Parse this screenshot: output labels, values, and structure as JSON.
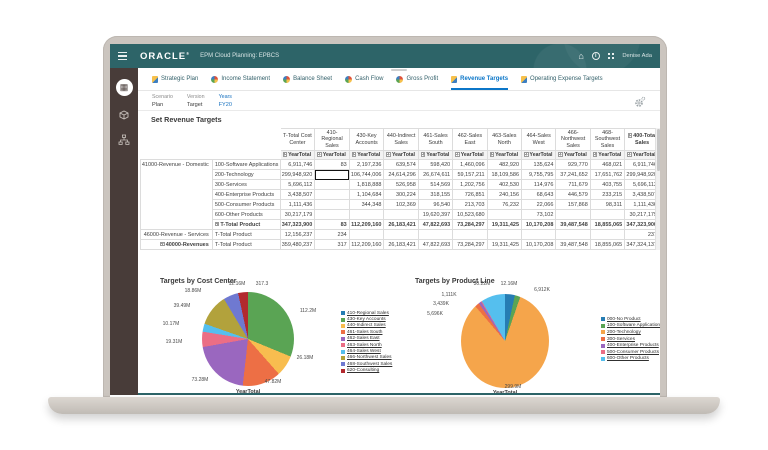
{
  "window": {
    "brand": "ORACLE",
    "brand_mark": "®",
    "app_title": "EPM Cloud Planning: EPBCS",
    "user": "Denise Ada",
    "header_icons": [
      "hamburger-icon",
      "home-icon",
      "info-icon",
      "apps-grid-icon"
    ]
  },
  "sidebar": {
    "icons": [
      "forms-grid-icon",
      "cube-icon",
      "org-chart-icon"
    ]
  },
  "tabs": [
    {
      "label": "Strategic Plan",
      "icon": "form",
      "active": false
    },
    {
      "label": "Income Statement",
      "icon": "chart",
      "active": false
    },
    {
      "label": "Balance Sheet",
      "icon": "chart",
      "active": false
    },
    {
      "label": "Cash Flow",
      "icon": "chart",
      "active": false
    },
    {
      "label": "Gross Profit",
      "icon": "chart",
      "active": false
    },
    {
      "label": "Revenue Targets",
      "icon": "form",
      "active": true
    },
    {
      "label": "Operating Expense Targets",
      "icon": "form",
      "active": false
    }
  ],
  "pov": {
    "items": [
      {
        "dim": "Scenario",
        "member": "Plan",
        "link": false
      },
      {
        "dim": "Version",
        "member": "Target",
        "link": false
      },
      {
        "dim": "Years",
        "member": "FY20",
        "link": true
      }
    ]
  },
  "page_title": "Set Revenue Targets",
  "grid": {
    "columns": [
      "T-Total Cost Center",
      "410-Regional Sales",
      "430-Key Accounts",
      "440-Indirect Sales",
      "461-Sales South",
      "462-Sales East",
      "463-Sales North",
      "464-Sales West",
      "466-Northwest Sales",
      "468-Southwest Sales",
      "400-Total Sales"
    ],
    "bold_columns": [
      10
    ],
    "subheader": "YearTotal",
    "rows": [
      {
        "group": {
          "label": "41000-Revenue - Domestic",
          "span": 7
        },
        "member": "100-Software Applications",
        "values": [
          "6,911,746",
          "83",
          "2,197,236",
          "639,574",
          "598,420",
          "1,460,096",
          "482,920",
          "135,624",
          "929,770",
          "468,021",
          "6,911,746"
        ]
      },
      {
        "member": "200-Technology",
        "selected_col": 1,
        "values": [
          "299,948,920",
          "",
          "106,744,006",
          "24,614,296",
          "26,674,611",
          "59,157,211",
          "18,109,586",
          "9,755,795",
          "37,241,652",
          "17,651,762",
          "299,948,920"
        ]
      },
      {
        "member": "300-Services",
        "values": [
          "5,696,112",
          "",
          "1,818,888",
          "526,958",
          "514,569",
          "1,202,756",
          "402,530",
          "114,976",
          "711,679",
          "403,755",
          "5,696,112"
        ]
      },
      {
        "member": "400-Enterprise Products",
        "values": [
          "3,438,507",
          "",
          "1,104,684",
          "300,224",
          "318,155",
          "726,851",
          "240,156",
          "68,643",
          "446,579",
          "233,215",
          "3,438,507"
        ]
      },
      {
        "member": "500-Consumer Products",
        "values": [
          "1,111,436",
          "",
          "344,348",
          "102,369",
          "96,540",
          "213,703",
          "76,232",
          "22,066",
          "157,868",
          "98,311",
          "1,111,436"
        ]
      },
      {
        "member": "600-Other Products",
        "values": [
          "30,217,179",
          "",
          "",
          "",
          "19,620,397",
          "10,523,680",
          "",
          "73,102",
          "",
          "",
          "30,217,179"
        ]
      },
      {
        "member": "T-Total Product",
        "member_bold": true,
        "member_expand": true,
        "bold": true,
        "values": [
          "347,323,900",
          "83",
          "112,209,160",
          "26,183,421",
          "47,822,693",
          "73,284,297",
          "19,311,425",
          "10,170,208",
          "39,487,548",
          "18,855,065",
          "347,323,900"
        ]
      },
      {
        "group": {
          "label": "46000-Revenue - Services",
          "span": 1
        },
        "member": "T-Total Product",
        "values": [
          "12,156,237",
          "234",
          "",
          "",
          "",
          "",
          "",
          "",
          "",
          "",
          "237"
        ]
      },
      {
        "group": {
          "label": "40000-Revenues",
          "span": 1,
          "bold": true,
          "expand": true
        },
        "member": "T-Total Product",
        "values": [
          "359,480,237",
          "317",
          "112,209,160",
          "26,183,421",
          "47,822,693",
          "73,284,297",
          "19,311,425",
          "10,170,208",
          "39,487,548",
          "18,855,065",
          "347,324,137"
        ]
      }
    ]
  },
  "chart_data": [
    {
      "type": "pie",
      "title": "Targets by Cost Center",
      "axis_label": "YearTotal",
      "legend_position": "right",
      "slices": [
        {
          "name": "410-Regional Sales",
          "value": 317.3,
          "label": "317.3",
          "color": "#267db3"
        },
        {
          "name": "430-Key Accounts",
          "value": 112200000,
          "label": "112.2M",
          "color": "#5aa454"
        },
        {
          "name": "440-Indirect Sales",
          "value": 26180000,
          "label": "26.18M",
          "color": "#f8bd4f"
        },
        {
          "name": "461-Sales South",
          "value": 47820000,
          "label": "47.82M",
          "color": "#ed6f45"
        },
        {
          "name": "462-Sales East",
          "value": 73280000,
          "label": "73.28M",
          "color": "#9a67bf"
        },
        {
          "name": "463-Sales North",
          "value": 19310000,
          "label": "19.31M",
          "color": "#eb6e85"
        },
        {
          "name": "464-Sales West",
          "value": 10170000,
          "label": "10.17M",
          "color": "#55bfee"
        },
        {
          "name": "466-Northwest Sales",
          "value": 39490000,
          "label": "39.49M",
          "color": "#b2a23c"
        },
        {
          "name": "468-Southwest Sales",
          "value": 18860000,
          "label": "18.86M",
          "color": "#6f79d1"
        },
        {
          "name": "620-Consulting",
          "value": 12160000,
          "label": "12.16M",
          "color": "#b2292e"
        }
      ]
    },
    {
      "type": "pie",
      "title": "Targets by Product Line",
      "axis_label": "YearTotal",
      "legend_position": "right",
      "slices": [
        {
          "name": "000-No Product",
          "value": 12160000,
          "label": "12.16M",
          "color": "#267db3"
        },
        {
          "name": "100-Software Applications",
          "value": 6912000,
          "label": "6,912K",
          "color": "#5aa454"
        },
        {
          "name": "200-Technology",
          "value": 299900000,
          "label": "299.9M",
          "color": "#f5a54b"
        },
        {
          "name": "300-Services",
          "value": 5696000,
          "label": "5,696K",
          "color": "#ed6f45"
        },
        {
          "name": "400-Enterprise Products",
          "value": 3439000,
          "label": "3,439K",
          "color": "#9a67bf"
        },
        {
          "name": "500-Consumer Products",
          "value": 1111000,
          "label": "1,111K",
          "color": "#eb6e85"
        },
        {
          "name": "600-Other Products",
          "value": 30220000,
          "label": "30.22M",
          "color": "#55bfee"
        }
      ]
    }
  ]
}
